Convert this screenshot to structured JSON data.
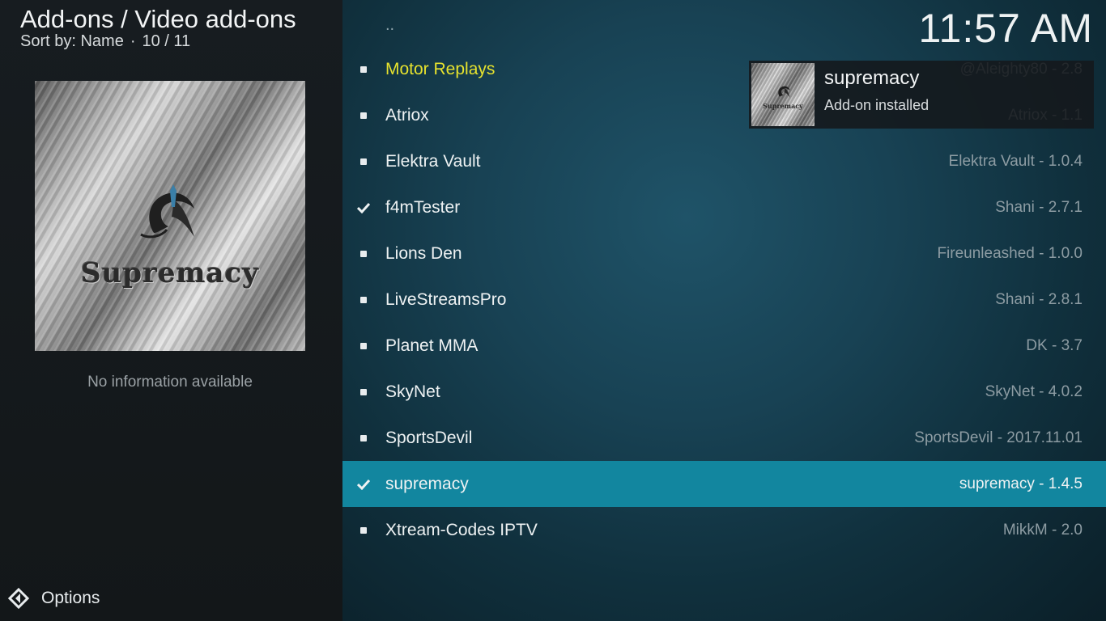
{
  "header": {
    "title": "Add-ons / Video add-ons",
    "sort_label": "Sort by: Name",
    "separator": "·",
    "position": "10 / 11"
  },
  "clock": "11:57 AM",
  "thumbnail": {
    "logo_text": "Supremacy"
  },
  "info_text": "No information available",
  "options_label": "Options",
  "parent_item": "..",
  "notification": {
    "title": "supremacy",
    "message": "Add-on installed",
    "thumb_logo": "Supremacy"
  },
  "list": [
    {
      "name": "Motor Replays",
      "meta": "@Aleighty80 - 2.8",
      "mark": "bullet",
      "highlight": true,
      "selected": false
    },
    {
      "name": "Atriox",
      "meta": "Atriox - 1.1",
      "mark": "bullet",
      "highlight": false,
      "selected": false
    },
    {
      "name": "Elektra Vault",
      "meta": "Elektra Vault - 1.0.4",
      "mark": "bullet",
      "highlight": false,
      "selected": false
    },
    {
      "name": "f4mTester",
      "meta": "Shani - 2.7.1",
      "mark": "check",
      "highlight": false,
      "selected": false
    },
    {
      "name": "Lions Den",
      "meta": "Fireunleashed - 1.0.0",
      "mark": "bullet",
      "highlight": false,
      "selected": false
    },
    {
      "name": "LiveStreamsPro",
      "meta": "Shani - 2.8.1",
      "mark": "bullet",
      "highlight": false,
      "selected": false
    },
    {
      "name": "Planet MMA",
      "meta": "DK - 3.7",
      "mark": "bullet",
      "highlight": false,
      "selected": false
    },
    {
      "name": "SkyNet",
      "meta": "SkyNet - 4.0.2",
      "mark": "bullet",
      "highlight": false,
      "selected": false
    },
    {
      "name": "SportsDevil",
      "meta": "SportsDevil - 2017.11.01",
      "mark": "bullet",
      "highlight": false,
      "selected": false
    },
    {
      "name": "supremacy",
      "meta": "supremacy - 1.4.5",
      "mark": "check",
      "highlight": false,
      "selected": true
    },
    {
      "name": "Xtream-Codes IPTV",
      "meta": "MikkM - 2.0",
      "mark": "bullet",
      "highlight": false,
      "selected": false
    }
  ],
  "colors": {
    "selected_row": "#12869f",
    "highlight_text": "#e6e22e"
  }
}
